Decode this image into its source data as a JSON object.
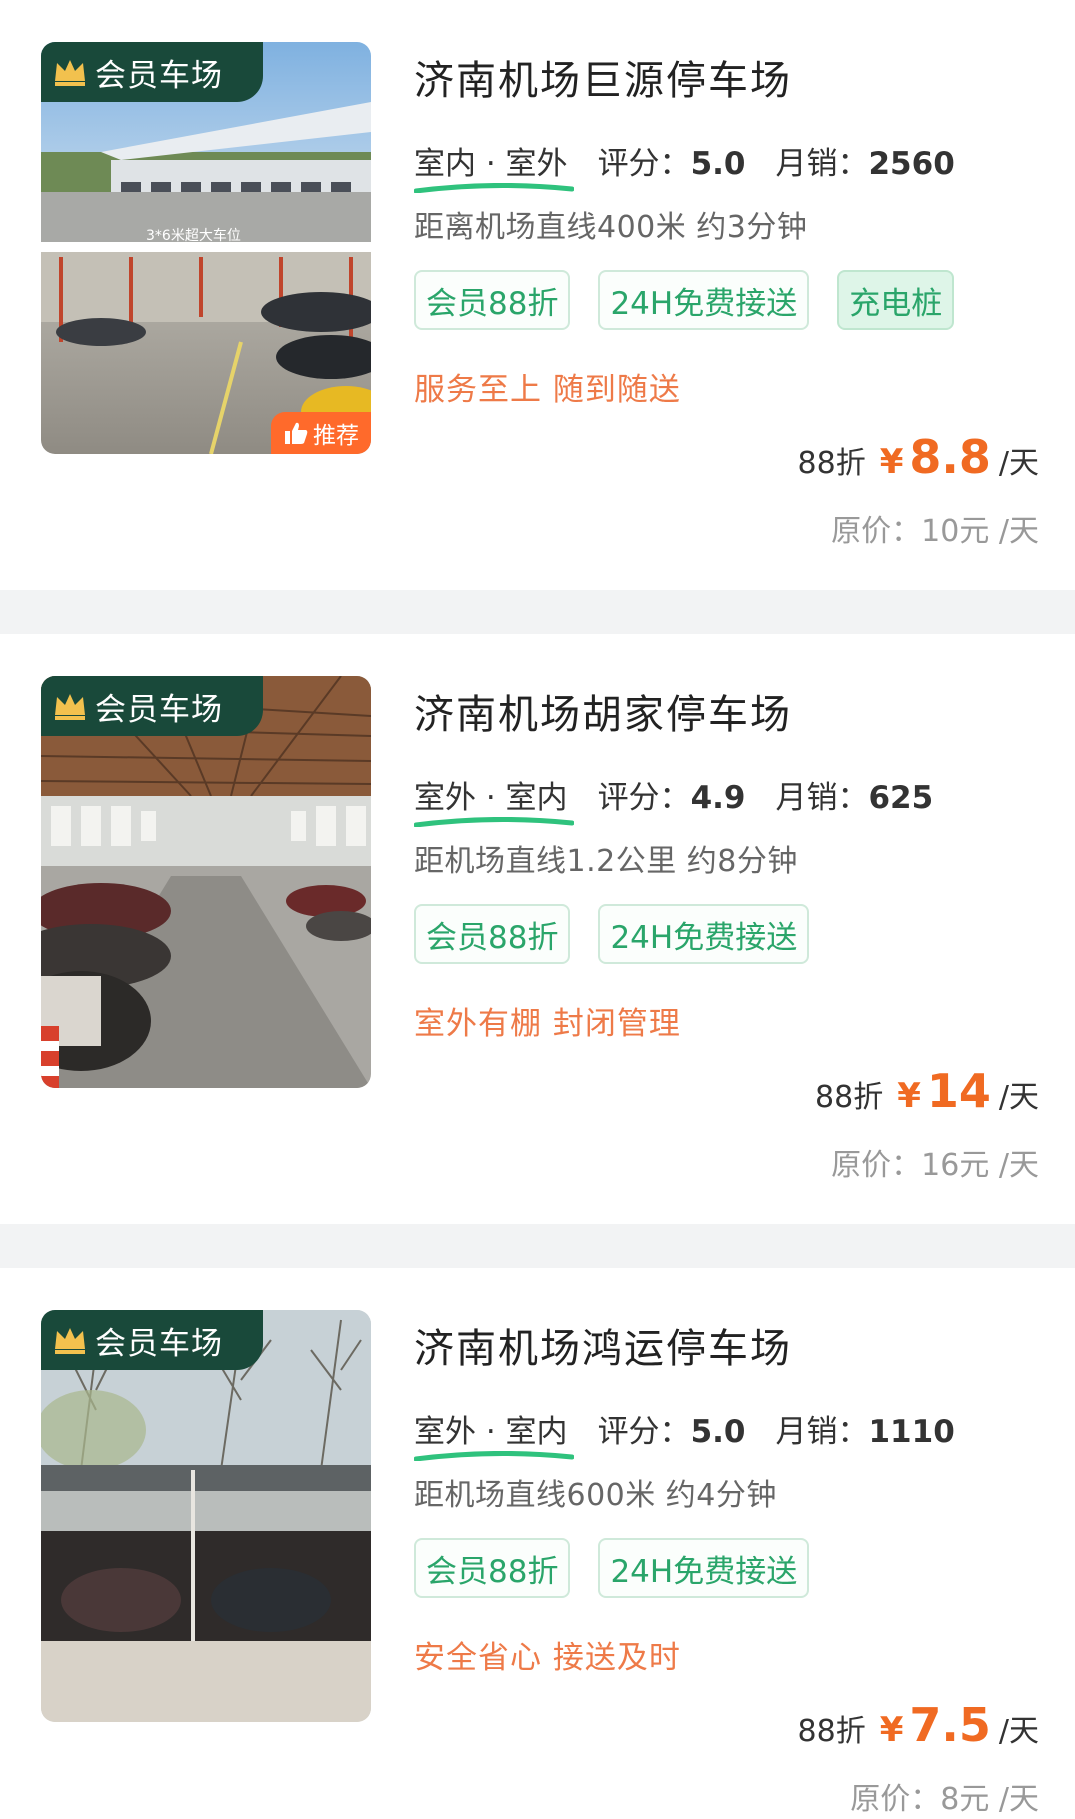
{
  "member_badge_label": "会员车场",
  "recommend_label": "推荐",
  "listings": [
    {
      "title": "济南机场巨源停车场",
      "env": "室内 · 室外",
      "rating_label": "评分：",
      "rating": "5.0",
      "sales_label": "月销：",
      "sales": "2560",
      "distance": "距离机场直线400米 约3分钟",
      "tags": [
        "会员88折",
        "24H免费接送",
        "充电桩"
      ],
      "slogan": "服务至上 随到随送",
      "discount_label": "88折",
      "currency": "¥",
      "price": "8.8",
      "unit": "/天",
      "original_price": "原价：10元 /天",
      "photo_caption": "3*6米超大车位",
      "recommended": true
    },
    {
      "title": "济南机场胡家停车场",
      "env": "室外 · 室内",
      "rating_label": "评分：",
      "rating": "4.9",
      "sales_label": "月销：",
      "sales": "625",
      "distance": "距机场直线1.2公里 约8分钟",
      "tags": [
        "会员88折",
        "24H免费接送"
      ],
      "slogan": "室外有棚 封闭管理",
      "discount_label": "88折",
      "currency": "¥",
      "price": "14",
      "unit": "/天",
      "original_price": "原价：16元 /天",
      "recommended": false
    },
    {
      "title": "济南机场鸿运停车场",
      "env": "室外 · 室内",
      "rating_label": "评分：",
      "rating": "5.0",
      "sales_label": "月销：",
      "sales": "1110",
      "distance": "距机场直线600米 约4分钟",
      "tags": [
        "会员88折",
        "24H免费接送"
      ],
      "slogan": "安全省心 接送及时",
      "discount_label": "88折",
      "currency": "¥",
      "price": "7.5",
      "unit": "/天",
      "original_price": "原价：8元 /天",
      "recommended": false
    }
  ],
  "colors": {
    "accent_orange": "#f06a22",
    "tag_green": "#2aa56a",
    "badge_green": "#19493a",
    "separator": "#f2f3f4"
  }
}
